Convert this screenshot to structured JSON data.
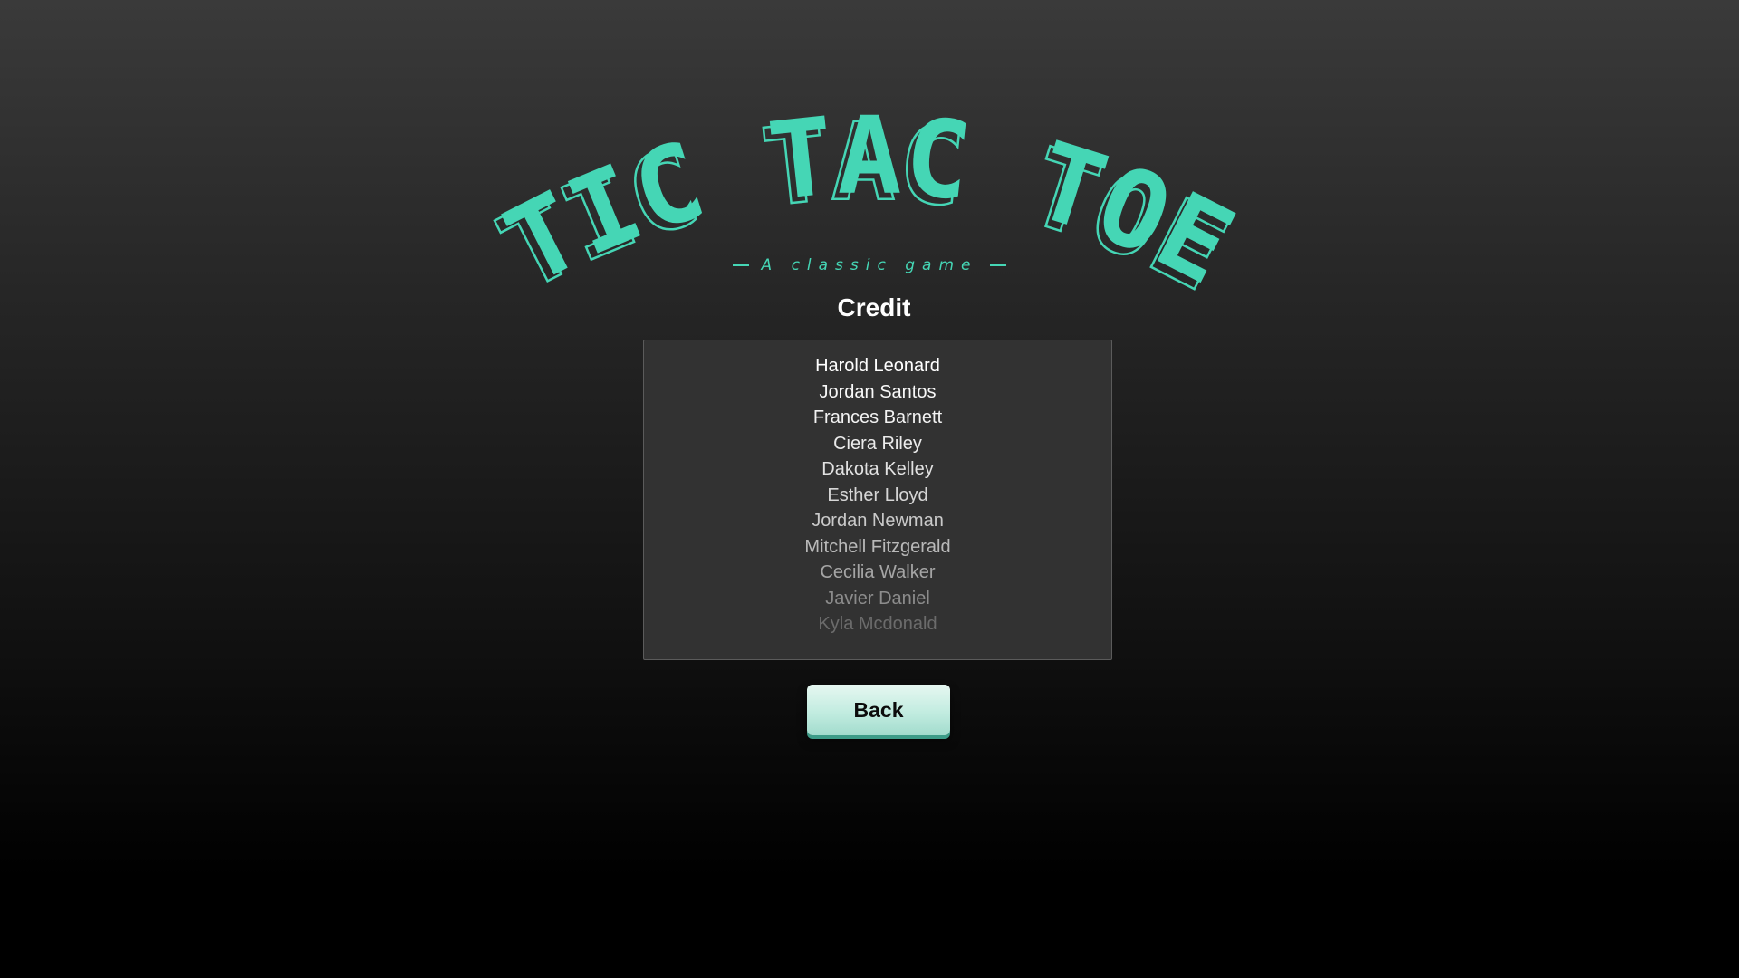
{
  "logo": {
    "title": "TIC TAC TOE",
    "subtitle": "A classic game",
    "accent_color": "#45d6b5"
  },
  "screen": {
    "heading": "Credit"
  },
  "credits": [
    "Harold Leonard",
    "Jordan Santos",
    "Frances Barnett",
    "Ciera Riley",
    "Dakota Kelley",
    "Esther Lloyd",
    "Jordan Newman",
    "Mitchell Fitzgerald",
    "Cecilia Walker",
    "Javier Daniel",
    "Kyla Mcdonald"
  ],
  "credit_opacity": [
    1.0,
    0.97,
    0.94,
    0.9,
    0.86,
    0.8,
    0.74,
    0.66,
    0.56,
    0.44,
    0.28
  ],
  "buttons": {
    "back_label": "Back"
  }
}
